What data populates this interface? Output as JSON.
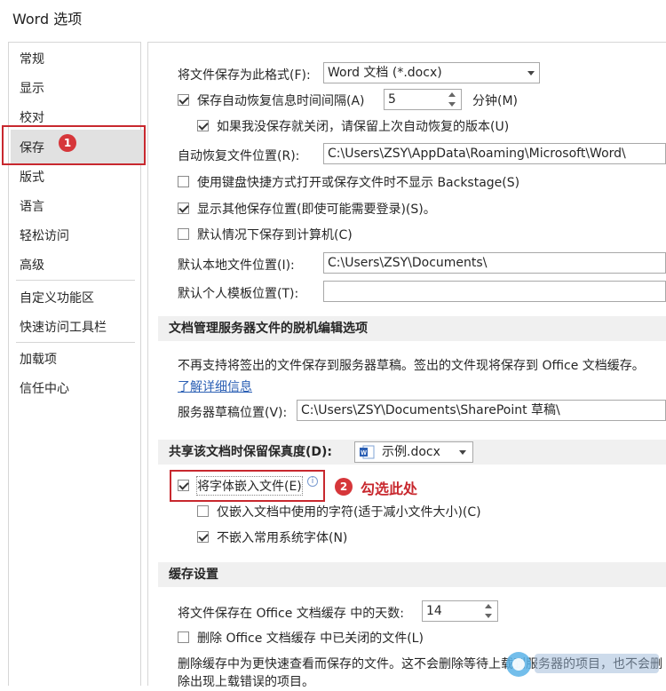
{
  "window": {
    "title": "Word 选项"
  },
  "sidebar": {
    "items": [
      {
        "label": "常规"
      },
      {
        "label": "显示"
      },
      {
        "label": "校对"
      },
      {
        "label": "保存"
      },
      {
        "label": "版式"
      },
      {
        "label": "语言"
      },
      {
        "label": "轻松访问"
      },
      {
        "label": "高级"
      },
      {
        "label": "自定义功能区"
      },
      {
        "label": "快速访问工具栏"
      },
      {
        "label": "加载项"
      },
      {
        "label": "信任中心"
      }
    ],
    "selected": "保存"
  },
  "annotations": {
    "badge1": "1",
    "badge2": "2",
    "note2": "勾选此处"
  },
  "save": {
    "format_label": "将文件保存为此格式(F):",
    "format_value": "Word 文档 (*.docx)",
    "autorecover_label": "保存自动恢复信息时间间隔(A)",
    "autorecover_checked": true,
    "autorecover_minutes": "5",
    "minutes_label": "分钟(M)",
    "keep_last_label": "如果我没保存就关闭，请保留上次自动恢复的版本(U)",
    "keep_last_checked": true,
    "autorecover_path_label": "自动恢复文件位置(R):",
    "autorecover_path": "C:\\Users\\ZSY\\AppData\\Roaming\\Microsoft\\Word\\",
    "no_backstage_label": "使用键盘快捷方式打开或保存文件时不显示 Backstage(S)",
    "no_backstage_checked": false,
    "show_more_label": "显示其他保存位置(即使可能需要登录)(S)。",
    "show_more_checked": true,
    "save_computer_label": "默认情况下保存到计算机(C)",
    "save_computer_checked": false,
    "local_path_label": "默认本地文件位置(I):",
    "local_path": "C:\\Users\\ZSY\\Documents\\",
    "template_path_label": "默认个人模板位置(T):",
    "template_path": ""
  },
  "offline": {
    "header": "文档管理服务器文件的脱机编辑选项",
    "desc": "不再支持将签出的文件保存到服务器草稿。签出的文件现将保存到 Office 文档缓存。",
    "learn_more": "了解详细信息",
    "drafts_label": "服务器草稿位置(V):",
    "drafts_path": "C:\\Users\\ZSY\\Documents\\SharePoint 草稿\\"
  },
  "fidelity": {
    "header": "共享该文档时保留保真度(D):",
    "doc_value": "示例.docx",
    "embed_label": "将字体嵌入文件(E)",
    "embed_checked": true,
    "only_used_label": "仅嵌入文档中使用的字符(适于减小文件大小)(C)",
    "only_used_checked": false,
    "no_common_label": "不嵌入常用系统字体(N)",
    "no_common_checked": true
  },
  "cache": {
    "header": "缓存设置",
    "days_label": "将文件保存在 Office 文档缓存 中的天数:",
    "days_value": "14",
    "delete_label": "删除 Office 文档缓存 中已关闭的文件(L)",
    "delete_checked": false,
    "note": "删除缓存中为更快速查看而保存的文件。这不会删除等待上载到服务器的项目，也不会删除出现上载错误的项目。"
  },
  "colors": {
    "annotation_red": "#c8282e",
    "link_blue": "#2b5fb4",
    "selected_bg": "#e1e1e1"
  }
}
